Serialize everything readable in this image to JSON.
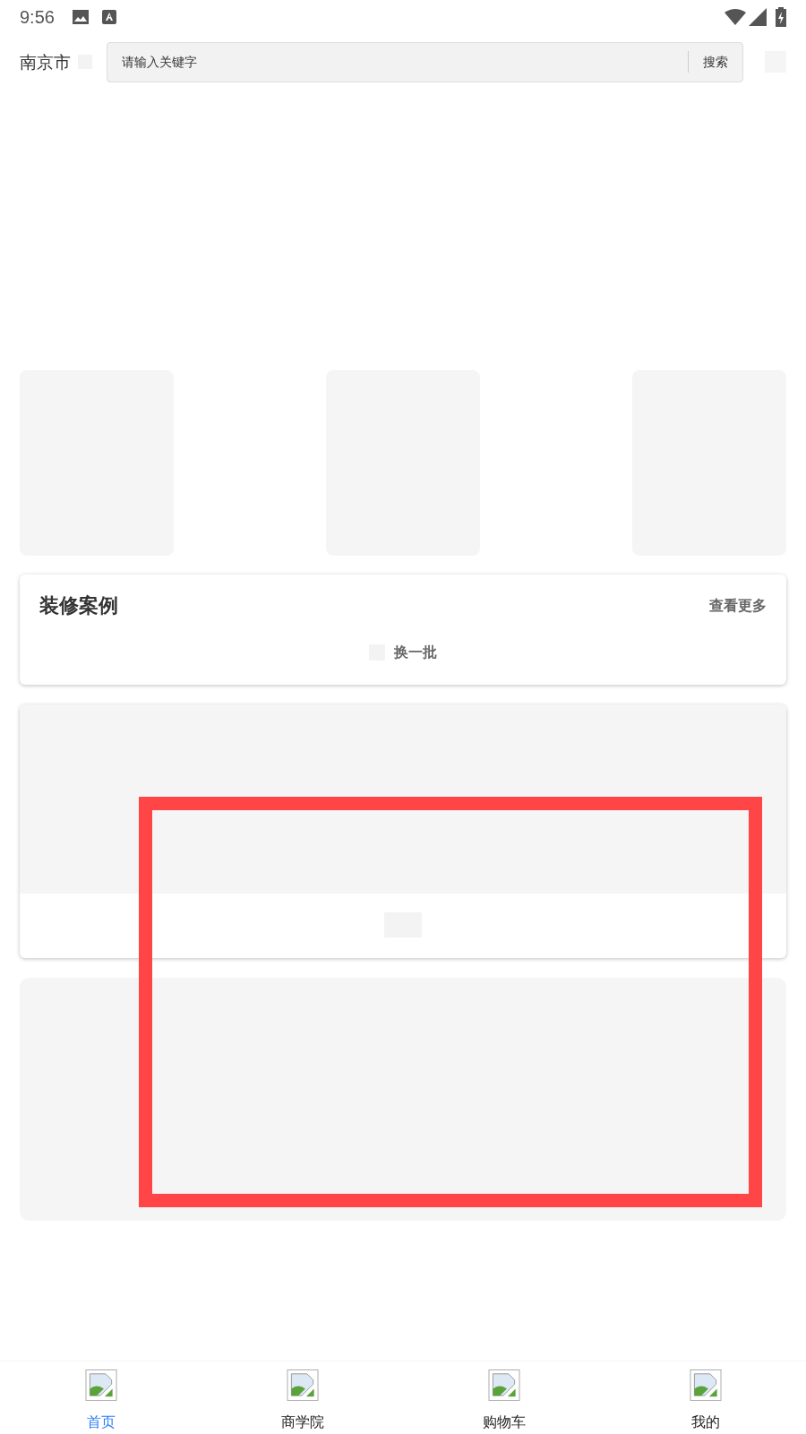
{
  "status_bar": {
    "time": "9:56"
  },
  "header": {
    "city": "南京市",
    "search": {
      "placeholder": "请输入关键字",
      "button": "搜索"
    }
  },
  "case_section": {
    "title": "装修案例",
    "more": "查看更多",
    "refresh": "换一批"
  },
  "tabs": [
    {
      "label": "首页",
      "selected": true
    },
    {
      "label": "商学院",
      "selected": false
    },
    {
      "label": "购物车",
      "selected": false
    },
    {
      "label": "我的",
      "selected": false
    }
  ]
}
